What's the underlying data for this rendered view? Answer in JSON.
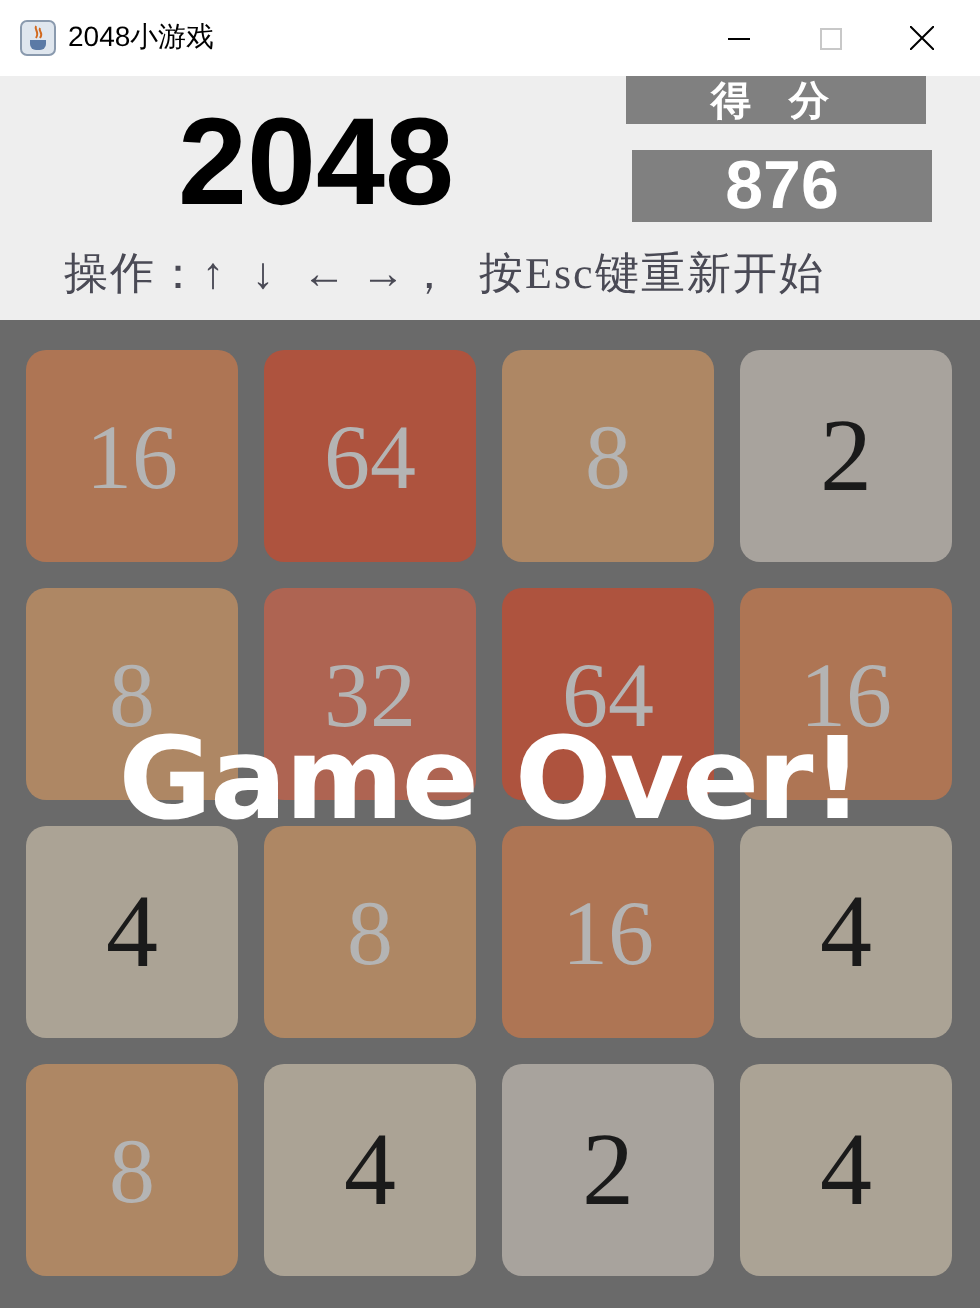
{
  "window": {
    "title": "2048小游戏",
    "maximize_disabled": true
  },
  "header": {
    "logo": "2048",
    "score_label": "得 分",
    "score": "876",
    "instructions": "操作：↑  ↓  ← →，  按Esc键重新开始"
  },
  "board": {
    "tiles": [
      {
        "value": "16",
        "color": "#ae7554",
        "kind": "high"
      },
      {
        "value": "64",
        "color": "#ae533e",
        "kind": "high"
      },
      {
        "value": "8",
        "color": "#ae8764",
        "kind": "high"
      },
      {
        "value": "2",
        "color": "#a8a39d",
        "kind": "low"
      },
      {
        "value": "8",
        "color": "#ae8764",
        "kind": "high"
      },
      {
        "value": "32",
        "color": "#ae6452",
        "kind": "high"
      },
      {
        "value": "64",
        "color": "#ae533e",
        "kind": "high"
      },
      {
        "value": "16",
        "color": "#ae7554",
        "kind": "high"
      },
      {
        "value": "4",
        "color": "#aba395",
        "kind": "low"
      },
      {
        "value": "8",
        "color": "#ae8764",
        "kind": "high"
      },
      {
        "value": "16",
        "color": "#ae7554",
        "kind": "high"
      },
      {
        "value": "4",
        "color": "#aba395",
        "kind": "low"
      },
      {
        "value": "8",
        "color": "#ae8764",
        "kind": "high"
      },
      {
        "value": "4",
        "color": "#aba395",
        "kind": "low"
      },
      {
        "value": "2",
        "color": "#a8a39d",
        "kind": "low"
      },
      {
        "value": "4",
        "color": "#aba395",
        "kind": "low"
      }
    ],
    "overlay": "Game Over!"
  }
}
